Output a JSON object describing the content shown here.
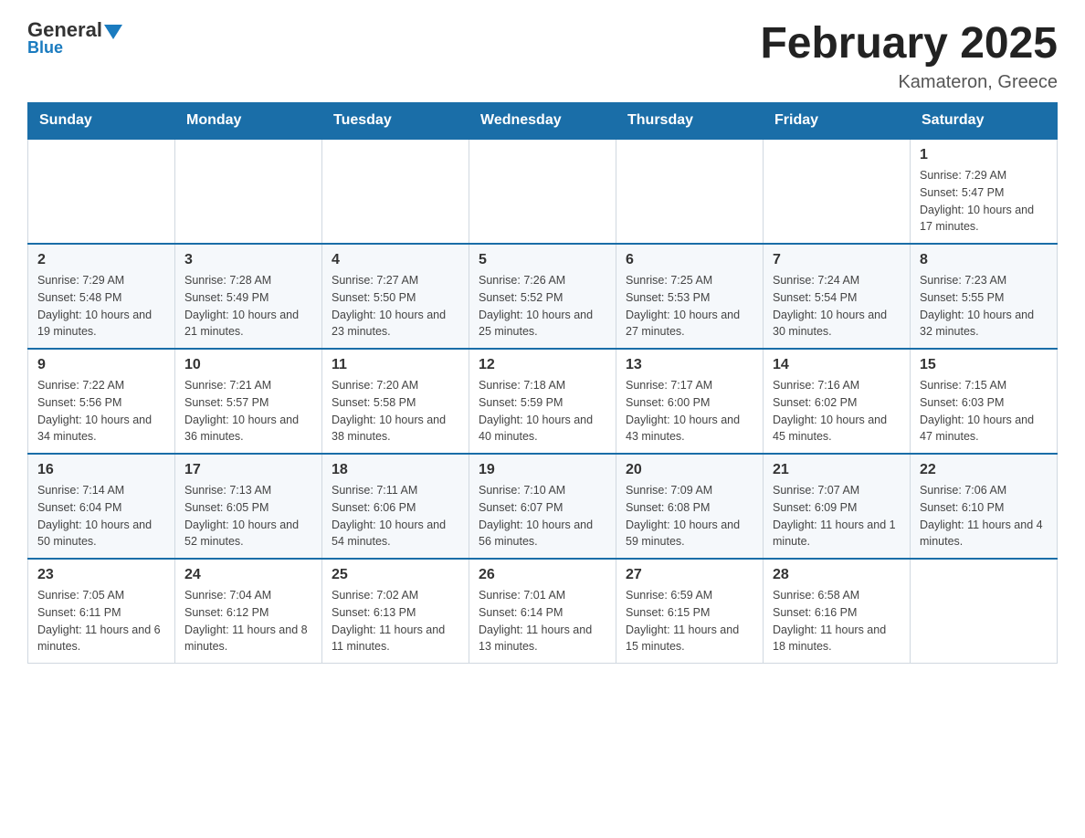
{
  "header": {
    "title": "February 2025",
    "subtitle": "Kamateron, Greece",
    "logo_general": "General",
    "logo_blue": "Blue"
  },
  "weekdays": [
    "Sunday",
    "Monday",
    "Tuesday",
    "Wednesday",
    "Thursday",
    "Friday",
    "Saturday"
  ],
  "weeks": [
    [
      {
        "day": "",
        "info": ""
      },
      {
        "day": "",
        "info": ""
      },
      {
        "day": "",
        "info": ""
      },
      {
        "day": "",
        "info": ""
      },
      {
        "day": "",
        "info": ""
      },
      {
        "day": "",
        "info": ""
      },
      {
        "day": "1",
        "info": "Sunrise: 7:29 AM\nSunset: 5:47 PM\nDaylight: 10 hours and 17 minutes."
      }
    ],
    [
      {
        "day": "2",
        "info": "Sunrise: 7:29 AM\nSunset: 5:48 PM\nDaylight: 10 hours and 19 minutes."
      },
      {
        "day": "3",
        "info": "Sunrise: 7:28 AM\nSunset: 5:49 PM\nDaylight: 10 hours and 21 minutes."
      },
      {
        "day": "4",
        "info": "Sunrise: 7:27 AM\nSunset: 5:50 PM\nDaylight: 10 hours and 23 minutes."
      },
      {
        "day": "5",
        "info": "Sunrise: 7:26 AM\nSunset: 5:52 PM\nDaylight: 10 hours and 25 minutes."
      },
      {
        "day": "6",
        "info": "Sunrise: 7:25 AM\nSunset: 5:53 PM\nDaylight: 10 hours and 27 minutes."
      },
      {
        "day": "7",
        "info": "Sunrise: 7:24 AM\nSunset: 5:54 PM\nDaylight: 10 hours and 30 minutes."
      },
      {
        "day": "8",
        "info": "Sunrise: 7:23 AM\nSunset: 5:55 PM\nDaylight: 10 hours and 32 minutes."
      }
    ],
    [
      {
        "day": "9",
        "info": "Sunrise: 7:22 AM\nSunset: 5:56 PM\nDaylight: 10 hours and 34 minutes."
      },
      {
        "day": "10",
        "info": "Sunrise: 7:21 AM\nSunset: 5:57 PM\nDaylight: 10 hours and 36 minutes."
      },
      {
        "day": "11",
        "info": "Sunrise: 7:20 AM\nSunset: 5:58 PM\nDaylight: 10 hours and 38 minutes."
      },
      {
        "day": "12",
        "info": "Sunrise: 7:18 AM\nSunset: 5:59 PM\nDaylight: 10 hours and 40 minutes."
      },
      {
        "day": "13",
        "info": "Sunrise: 7:17 AM\nSunset: 6:00 PM\nDaylight: 10 hours and 43 minutes."
      },
      {
        "day": "14",
        "info": "Sunrise: 7:16 AM\nSunset: 6:02 PM\nDaylight: 10 hours and 45 minutes."
      },
      {
        "day": "15",
        "info": "Sunrise: 7:15 AM\nSunset: 6:03 PM\nDaylight: 10 hours and 47 minutes."
      }
    ],
    [
      {
        "day": "16",
        "info": "Sunrise: 7:14 AM\nSunset: 6:04 PM\nDaylight: 10 hours and 50 minutes."
      },
      {
        "day": "17",
        "info": "Sunrise: 7:13 AM\nSunset: 6:05 PM\nDaylight: 10 hours and 52 minutes."
      },
      {
        "day": "18",
        "info": "Sunrise: 7:11 AM\nSunset: 6:06 PM\nDaylight: 10 hours and 54 minutes."
      },
      {
        "day": "19",
        "info": "Sunrise: 7:10 AM\nSunset: 6:07 PM\nDaylight: 10 hours and 56 minutes."
      },
      {
        "day": "20",
        "info": "Sunrise: 7:09 AM\nSunset: 6:08 PM\nDaylight: 10 hours and 59 minutes."
      },
      {
        "day": "21",
        "info": "Sunrise: 7:07 AM\nSunset: 6:09 PM\nDaylight: 11 hours and 1 minute."
      },
      {
        "day": "22",
        "info": "Sunrise: 7:06 AM\nSunset: 6:10 PM\nDaylight: 11 hours and 4 minutes."
      }
    ],
    [
      {
        "day": "23",
        "info": "Sunrise: 7:05 AM\nSunset: 6:11 PM\nDaylight: 11 hours and 6 minutes."
      },
      {
        "day": "24",
        "info": "Sunrise: 7:04 AM\nSunset: 6:12 PM\nDaylight: 11 hours and 8 minutes."
      },
      {
        "day": "25",
        "info": "Sunrise: 7:02 AM\nSunset: 6:13 PM\nDaylight: 11 hours and 11 minutes."
      },
      {
        "day": "26",
        "info": "Sunrise: 7:01 AM\nSunset: 6:14 PM\nDaylight: 11 hours and 13 minutes."
      },
      {
        "day": "27",
        "info": "Sunrise: 6:59 AM\nSunset: 6:15 PM\nDaylight: 11 hours and 15 minutes."
      },
      {
        "day": "28",
        "info": "Sunrise: 6:58 AM\nSunset: 6:16 PM\nDaylight: 11 hours and 18 minutes."
      },
      {
        "day": "",
        "info": ""
      }
    ]
  ]
}
